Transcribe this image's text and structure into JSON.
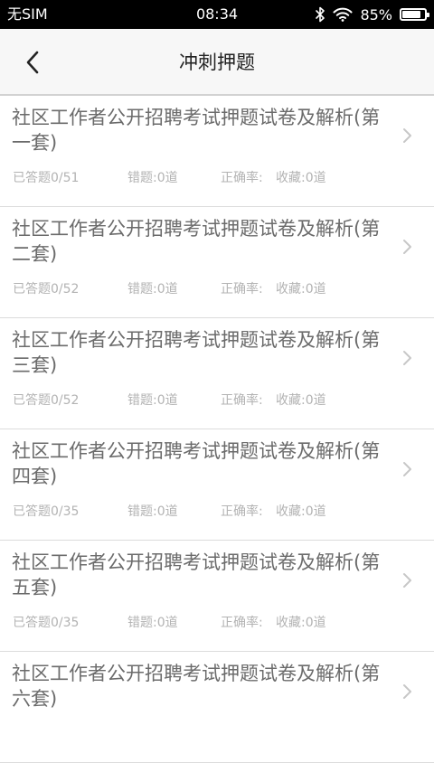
{
  "status_bar": {
    "carrier": "无SIM",
    "time": "08:34",
    "battery_percent": "85%",
    "battery_level": 0.85,
    "icons": [
      "bluetooth-icon",
      "wifi-icon",
      "battery-icon"
    ]
  },
  "nav": {
    "back_icon": "chevron-left-icon",
    "title": "冲刺押题"
  },
  "items": [
    {
      "title": "社区工作者公开招聘考试押题试卷及解析(第一套)",
      "answered": "已答题0/51",
      "wrong": "错题:0道",
      "correct": "正确率:",
      "favorites": "收藏:0道"
    },
    {
      "title": "社区工作者公开招聘考试押题试卷及解析(第二套)",
      "answered": "已答题0/52",
      "wrong": "错题:0道",
      "correct": "正确率:",
      "favorites": "收藏:0道"
    },
    {
      "title": "社区工作者公开招聘考试押题试卷及解析(第三套)",
      "answered": "已答题0/52",
      "wrong": "错题:0道",
      "correct": "正确率:",
      "favorites": "收藏:0道"
    },
    {
      "title": "社区工作者公开招聘考试押题试卷及解析(第四套)",
      "answered": "已答题0/35",
      "wrong": "错题:0道",
      "correct": "正确率:",
      "favorites": "收藏:0道"
    },
    {
      "title": "社区工作者公开招聘考试押题试卷及解析(第五套)",
      "answered": "已答题0/35",
      "wrong": "错题:0道",
      "correct": "正确率:",
      "favorites": "收藏:0道"
    },
    {
      "title": "社区工作者公开招聘考试押题试卷及解析(第六套)"
    }
  ],
  "colors": {
    "status_bar_bg": "#000000",
    "nav_bg": "#f7f7f7",
    "title_text": "#6b6b6b",
    "stat_text": "#b3b3b3",
    "divider": "#dcdcdc"
  }
}
